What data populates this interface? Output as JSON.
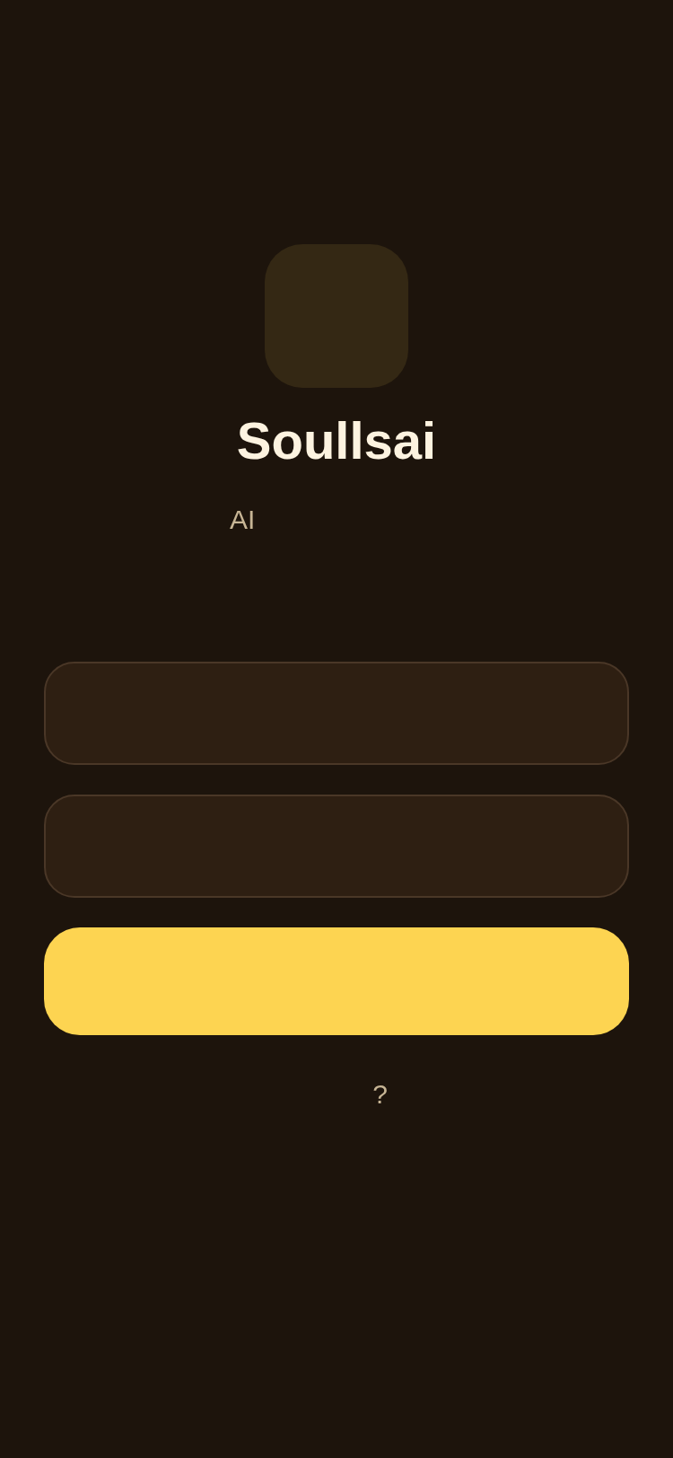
{
  "header": {
    "title": "Soullsai",
    "subtitle": "AI"
  },
  "fields": [
    {
      "kind": "input"
    },
    {
      "kind": "input"
    }
  ],
  "submit_button": {
    "kind": "primary"
  },
  "footer_link": {
    "text": "?"
  }
}
